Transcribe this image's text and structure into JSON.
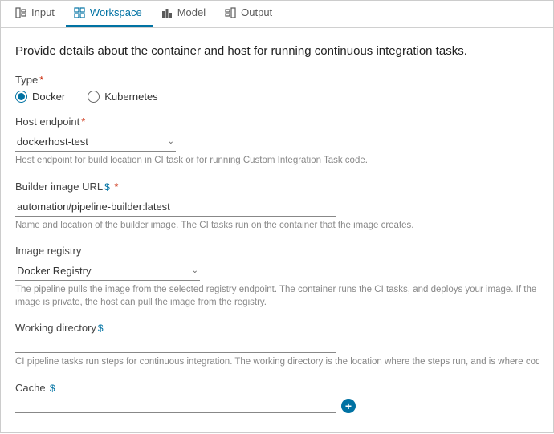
{
  "tabs": {
    "items": [
      {
        "label": "Input"
      },
      {
        "label": "Workspace"
      },
      {
        "label": "Model"
      },
      {
        "label": "Output"
      }
    ],
    "activeIndex": 1
  },
  "page": {
    "description": "Provide details about the container and host for running continuous integration tasks."
  },
  "type": {
    "label": "Type",
    "options": [
      "Docker",
      "Kubernetes"
    ],
    "selected": "Docker"
  },
  "hostEndpoint": {
    "label": "Host endpoint",
    "value": "dockerhost-test",
    "help": "Host endpoint for build location in CI task or for running Custom Integration Task code."
  },
  "builderImage": {
    "label": "Builder image URL",
    "value": "automation/pipeline-builder:latest",
    "help": "Name and location of the builder image. The CI tasks run on the container that the image creates."
  },
  "imageRegistry": {
    "label": "Image registry",
    "value": "Docker Registry",
    "help": "The pipeline pulls the image from the selected registry endpoint. The container runs the CI tasks, and deploys your image. If the image is private, the host can pull the image from the registry."
  },
  "workingDir": {
    "label": "Working directory",
    "value": "",
    "help": "CI pipeline tasks run steps for continuous integration. The working directory is the location where the steps run, and is where code is cloned."
  },
  "cache": {
    "label": "Cache"
  }
}
